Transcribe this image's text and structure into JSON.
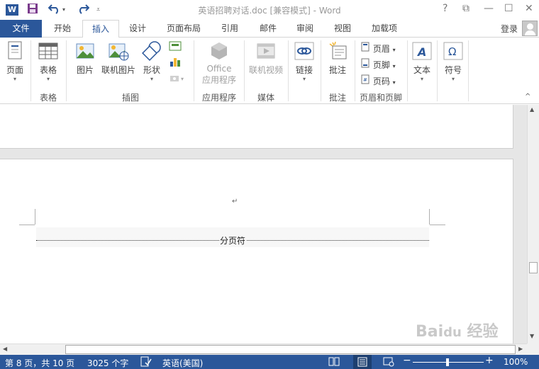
{
  "titlebar": {
    "title": "英语招聘对话.doc [兼容模式] - Word",
    "help": "?",
    "ribbon_options": "⧉",
    "minimize": "—",
    "maximize": "☐",
    "close": "✕"
  },
  "tabs": {
    "file": "文件",
    "home": "开始",
    "insert": "插入",
    "design": "设计",
    "layout": "页面布局",
    "references": "引用",
    "mailings": "邮件",
    "review": "审阅",
    "view": "视图",
    "addins": "加载项",
    "login": "登录"
  },
  "ribbon": {
    "pages": "页面",
    "table": "表格",
    "picture": "图片",
    "online_picture": "联机图片",
    "shapes": "形状",
    "office_line1": "Office",
    "office_line2": "应用程序",
    "online_video": "联机视频",
    "link": "链接",
    "comment": "批注",
    "header": "页眉",
    "footer": "页脚",
    "page_number": "页码",
    "text": "文本",
    "symbol": "符号",
    "groups": {
      "table": "表格",
      "illustrations": "插图",
      "apps": "应用程序",
      "media": "媒体",
      "comments": "批注",
      "header_footer": "页眉和页脚"
    }
  },
  "document": {
    "paragraph_mark": "↵",
    "page_break_label": "分页符"
  },
  "statusbar": {
    "page": "第 8 页，共 10 页",
    "words": "3025 个字",
    "language": "英语(美国)",
    "zoom": "100%"
  },
  "colors": {
    "brand": "#2b579a",
    "tab_active": "#2b579a"
  }
}
